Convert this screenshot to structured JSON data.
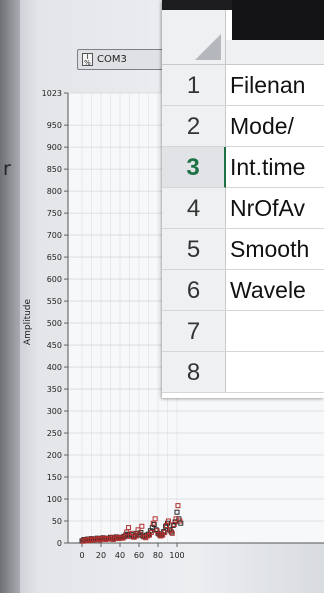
{
  "vi_panel": {
    "com_port": "COM3",
    "side_fragment": "r"
  },
  "chart_data": {
    "type": "scatter",
    "ylabel": "Amplitude",
    "xlabel": "",
    "yticks": [
      0,
      50,
      100,
      150,
      200,
      250,
      300,
      350,
      400,
      450,
      500,
      550,
      600,
      650,
      700,
      750,
      800,
      850,
      900,
      950,
      1023
    ],
    "xticks": [
      0,
      20,
      40,
      60,
      80,
      100
    ],
    "ylim": [
      0,
      1023
    ],
    "xlim": [
      -3,
      105
    ],
    "grid": true,
    "series": [
      {
        "color": "#2a2a2a",
        "x": [
          0,
          2,
          4,
          6,
          8,
          10,
          12,
          14,
          16,
          18,
          20,
          22,
          24,
          26,
          28,
          30,
          32,
          34,
          36,
          38,
          40,
          42,
          44,
          46,
          48,
          50,
          52,
          54,
          56,
          58,
          60,
          62,
          64,
          66,
          68,
          70,
          72,
          74,
          76,
          78,
          80,
          82,
          84,
          86,
          88,
          90,
          92,
          94,
          96,
          98,
          100,
          102,
          104
        ],
        "y": [
          5,
          8,
          6,
          9,
          7,
          10,
          8,
          9,
          11,
          8,
          10,
          12,
          9,
          11,
          10,
          13,
          9,
          12,
          14,
          11,
          13,
          12,
          15,
          18,
          20,
          16,
          19,
          14,
          17,
          22,
          18,
          24,
          16,
          15,
          18,
          20,
          28,
          35,
          42,
          30,
          22,
          18,
          20,
          26,
          38,
          45,
          30,
          25,
          40,
          48,
          70,
          55,
          45
        ]
      },
      {
        "color": "#b03030",
        "x": [
          1,
          3,
          5,
          7,
          9,
          11,
          13,
          15,
          17,
          19,
          21,
          23,
          25,
          27,
          29,
          31,
          33,
          35,
          37,
          39,
          41,
          43,
          45,
          47,
          49,
          51,
          53,
          55,
          57,
          59,
          61,
          63,
          65,
          67,
          69,
          71,
          73,
          75,
          77,
          79,
          81,
          83,
          85,
          87,
          89,
          91,
          93,
          95,
          97,
          99,
          101,
          103
        ],
        "y": [
          4,
          7,
          5,
          8,
          6,
          9,
          7,
          8,
          10,
          7,
          9,
          11,
          8,
          10,
          9,
          12,
          8,
          11,
          13,
          10,
          12,
          11,
          14,
          25,
          35,
          15,
          22,
          13,
          16,
          30,
          20,
          38,
          14,
          12,
          16,
          18,
          24,
          45,
          55,
          28,
          20,
          16,
          18,
          24,
          40,
          50,
          28,
          22,
          42,
          55,
          85,
          50
        ]
      }
    ]
  },
  "spreadsheet": {
    "rows": [
      {
        "num": "1",
        "text": "Filenan",
        "active": false
      },
      {
        "num": "2",
        "text": "Mode/",
        "active": false
      },
      {
        "num": "3",
        "text": "Int.time",
        "active": true
      },
      {
        "num": "4",
        "text": "NrOfAv",
        "active": false
      },
      {
        "num": "5",
        "text": "Smooth",
        "active": false
      },
      {
        "num": "6",
        "text": "Wavele",
        "active": false
      },
      {
        "num": "7",
        "text": "",
        "active": false
      },
      {
        "num": "8",
        "text": "",
        "active": false
      }
    ]
  }
}
